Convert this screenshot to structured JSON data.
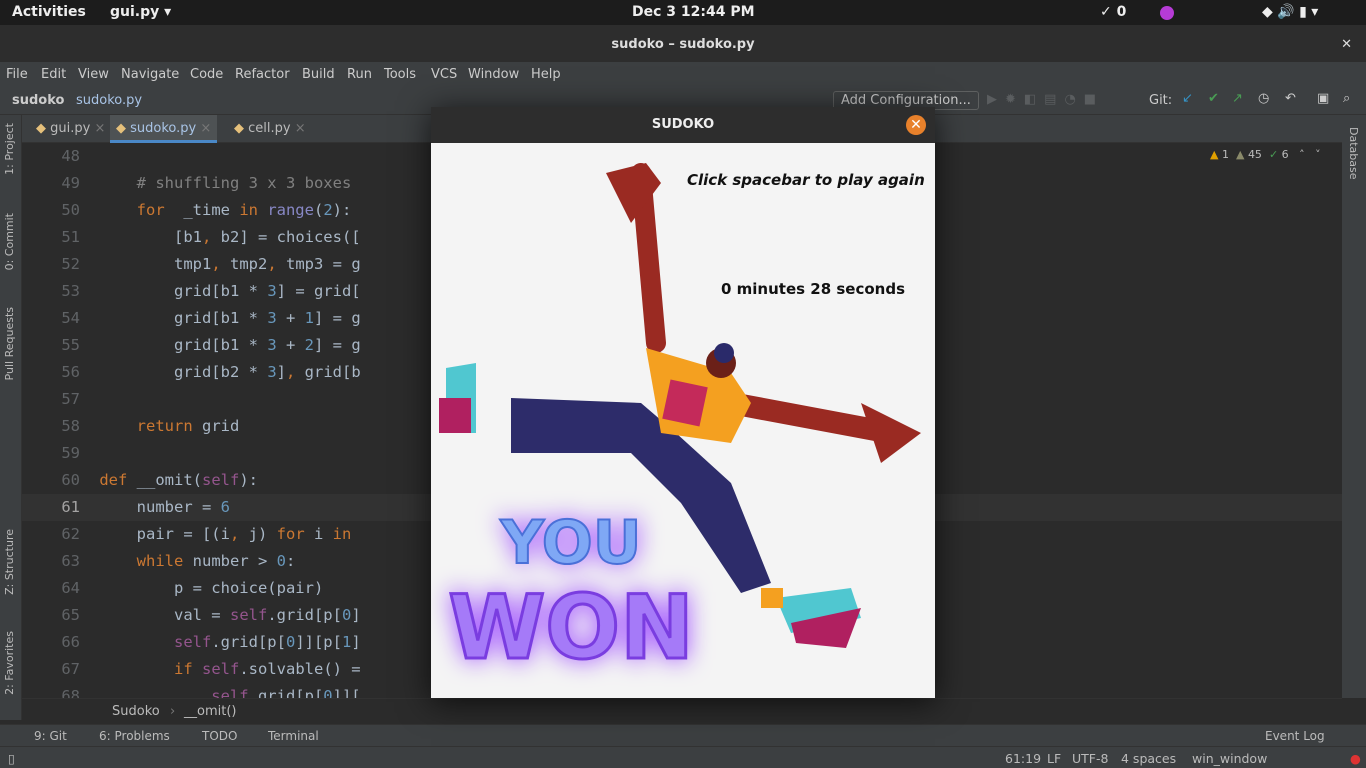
{
  "topbar": {
    "activities": "Activities",
    "app": "gui.py ▾",
    "datetime": "Dec 3  12:44 PM",
    "updates": "✓ 0"
  },
  "window": {
    "title": "sudoko – sudoko.py",
    "close": "✕"
  },
  "menu": [
    "File",
    "Edit",
    "View",
    "Navigate",
    "Code",
    "Refactor",
    "Build",
    "Run",
    "Tools",
    "VCS",
    "Window",
    "Help"
  ],
  "nav": {
    "project": "sudoko",
    "file": "sudoko.py",
    "add_config": "Add Configuration...",
    "git_label": "Git:"
  },
  "left_tools": [
    "1: Project",
    "0: Commit",
    "Pull Requests",
    "Z: Structure",
    "2: Favorites"
  ],
  "right_tools": [
    "Database"
  ],
  "tabs": [
    {
      "label": "gui.py"
    },
    {
      "label": "sudoko.py"
    },
    {
      "label": "cell.py"
    }
  ],
  "inspections": {
    "warnings": "1",
    "weak": "45",
    "typos": "6"
  },
  "code": [
    {
      "n": "48",
      "t": []
    },
    {
      "n": "49",
      "t": [
        [
          "cm",
          "        # shuffling 3 x 3 boxes"
        ]
      ]
    },
    {
      "n": "50",
      "t": [
        [
          "kw",
          "        for"
        ],
        [
          "",
          "  _time "
        ],
        [
          "kw",
          "in"
        ],
        [
          "fn",
          " range"
        ],
        [
          "",
          "("
        ],
        [
          "num",
          "2"
        ],
        [
          "",
          "):"
        ]
      ]
    },
    {
      "n": "51",
      "t": [
        [
          "",
          "            [b1"
        ],
        [
          "kw",
          ","
        ],
        [
          "",
          " b2] = choices(["
        ]
      ]
    },
    {
      "n": "52",
      "t": [
        [
          "",
          "            tmp1"
        ],
        [
          "kw",
          ","
        ],
        [
          "",
          " tmp2"
        ],
        [
          "kw",
          ","
        ],
        [
          "",
          " tmp3 = g"
        ]
      ]
    },
    {
      "n": "53",
      "t": [
        [
          "",
          "            grid[b1 * "
        ],
        [
          "num",
          "3"
        ],
        [
          "",
          "] = grid["
        ]
      ]
    },
    {
      "n": "54",
      "t": [
        [
          "",
          "            grid[b1 * "
        ],
        [
          "num",
          "3"
        ],
        [
          "",
          " + "
        ],
        [
          "num",
          "1"
        ],
        [
          "",
          "] = g"
        ]
      ]
    },
    {
      "n": "55",
      "t": [
        [
          "",
          "            grid[b1 * "
        ],
        [
          "num",
          "3"
        ],
        [
          "",
          " + "
        ],
        [
          "num",
          "2"
        ],
        [
          "",
          "] = g"
        ]
      ]
    },
    {
      "n": "56",
      "t": [
        [
          "",
          "            grid[b2 * "
        ],
        [
          "num",
          "3"
        ],
        [
          "",
          "]"
        ],
        [
          "kw",
          ","
        ],
        [
          "",
          " grid[b"
        ]
      ]
    },
    {
      "n": "57",
      "t": []
    },
    {
      "n": "58",
      "t": [
        [
          "kw",
          "        return"
        ],
        [
          "",
          " grid"
        ]
      ]
    },
    {
      "n": "59",
      "t": []
    },
    {
      "n": "60",
      "t": [
        [
          "kw",
          "    def"
        ],
        [
          "",
          " __omit("
        ],
        [
          "self",
          "self"
        ],
        [
          "",
          "):"
        ]
      ]
    },
    {
      "n": "61",
      "t": [
        [
          "",
          "        number = "
        ],
        [
          "num",
          "6"
        ]
      ]
    },
    {
      "n": "62",
      "t": [
        [
          "",
          "        pair = [(i"
        ],
        [
          "kw",
          ","
        ],
        [
          "",
          " j) "
        ],
        [
          "kw",
          "for"
        ],
        [
          "",
          " i "
        ],
        [
          "kw",
          "in"
        ]
      ]
    },
    {
      "n": "63",
      "t": [
        [
          "kw",
          "        while"
        ],
        [
          "",
          " number > "
        ],
        [
          "num",
          "0"
        ],
        [
          "",
          ":"
        ]
      ]
    },
    {
      "n": "64",
      "t": [
        [
          "",
          "            p = choice(pair)"
        ]
      ]
    },
    {
      "n": "65",
      "t": [
        [
          "",
          "            val = "
        ],
        [
          "self",
          "self"
        ],
        [
          "",
          ".grid[p["
        ],
        [
          "num",
          "0"
        ],
        [
          "",
          "]"
        ]
      ]
    },
    {
      "n": "66",
      "t": [
        [
          "self",
          "            self"
        ],
        [
          "",
          ".grid[p["
        ],
        [
          "num",
          "0"
        ],
        [
          "",
          "]][p["
        ],
        [
          "num",
          "1"
        ],
        [
          "",
          "]"
        ]
      ]
    },
    {
      "n": "67",
      "t": [
        [
          "kw",
          "            if"
        ],
        [
          "self",
          " self"
        ],
        [
          "",
          ".solvable() ="
        ]
      ]
    },
    {
      "n": "68",
      "t": [
        [
          "self",
          "                self"
        ],
        [
          "",
          ".grid[p["
        ],
        [
          "num",
          "0"
        ],
        [
          "",
          "]]["
        ]
      ]
    }
  ],
  "breadcrumb": {
    "class": "Sudoko",
    "method": "__omit()"
  },
  "bottom_tools": [
    "9: Git",
    "6: Problems",
    "TODO",
    "Terminal"
  ],
  "event_log": "Event Log",
  "status": {
    "position": "61:19",
    "eol": "LF",
    "encoding": "UTF-8",
    "indent": "4 spaces",
    "branch": "win_window"
  },
  "dialog": {
    "title": "SUDOKO",
    "close": "✕",
    "prompt": "Click spacebar to play again",
    "time": "0 minutes 28 seconds",
    "banner_top": "YOU",
    "banner_bottom": "WON"
  }
}
